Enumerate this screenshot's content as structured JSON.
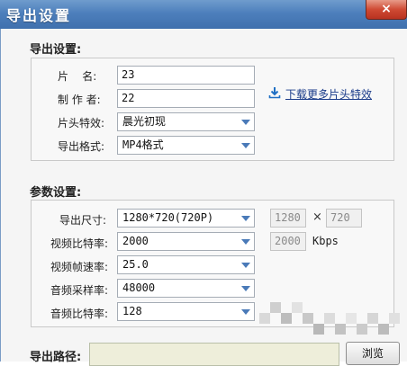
{
  "window": {
    "title": "导出设置",
    "close_glyph": "×"
  },
  "export_section": {
    "title": "导出设置:",
    "name_label": "片    名:",
    "name_value": "23",
    "author_label": "制 作 者:",
    "author_value": "22",
    "intro_effect_label": "片头特效:",
    "intro_effect_value": "晨光初现",
    "download_link": "下载更多片头特效",
    "format_label": "导出格式:",
    "format_value": "MP4格式"
  },
  "params_section": {
    "title": "参数设置:",
    "size_label": "导出尺寸:",
    "size_value": "1280*720(720P)",
    "width_value": "1280",
    "times_sign": "×",
    "height_value": "720",
    "video_bitrate_label": "视频比特率:",
    "video_bitrate_value": "2000",
    "video_bitrate_box": "2000",
    "bitrate_unit": "Kbps",
    "framerate_label": "视频帧速率:",
    "framerate_value": "25.0",
    "audio_samplerate_label": "音频采样率:",
    "audio_samplerate_value": "48000",
    "audio_bitrate_label": "音频比特率:",
    "audio_bitrate_value": "128"
  },
  "path_section": {
    "title": "导出路径:",
    "path_value": "",
    "browse_label": "浏览"
  },
  "icons": [
    "close-icon",
    "download-icon",
    "dropdown-arrow-icon"
  ],
  "colors": {
    "titlebar": "#4d7fbc",
    "link": "#1b3c8a",
    "dropdown_arrow": "#4a7ab8",
    "path_field_bg": "#eeeeda"
  }
}
